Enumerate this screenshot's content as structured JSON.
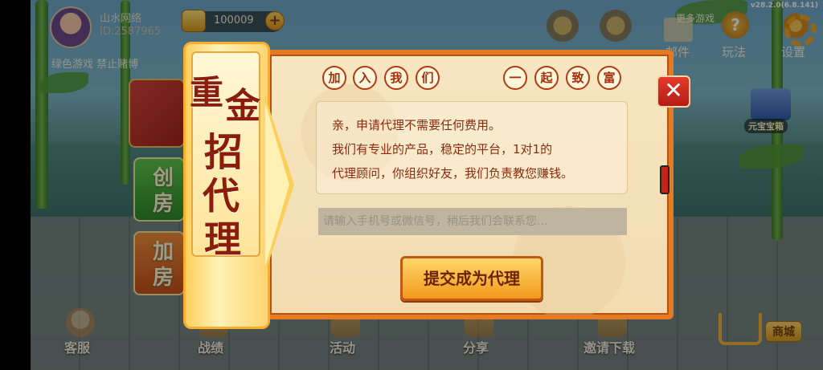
{
  "version": "v28.2.0(6.8.141)",
  "user": {
    "name": "山水网络",
    "id_text": "ID:2587965",
    "tagline": "绿色游戏  禁止赌博"
  },
  "currency": {
    "gold_amount": "100009",
    "add_symbol": "+"
  },
  "top_menu": {
    "more_games": "更多游戏",
    "mail": "邮件",
    "help": "玩法",
    "settings": "设置",
    "help_glyph": "?"
  },
  "left_panel": {
    "create_room": [
      "创",
      "房"
    ],
    "join_room": [
      "加",
      "房"
    ]
  },
  "treasure": {
    "label": "元宝宝箱"
  },
  "bottom_nav": {
    "service": "客服",
    "record": "战绩",
    "activity": "活动",
    "share": "分享",
    "invite": "邀请下载",
    "shop": "商城"
  },
  "modal": {
    "banner_chars": [
      "重",
      "金",
      "招",
      "代",
      "理"
    ],
    "join_chars": [
      "加",
      "入",
      "我",
      "们"
    ],
    "together_chars": [
      "一",
      "起",
      "致",
      "富"
    ],
    "message_lines": [
      "亲，申请代理不需要任何费用。",
      "我们有专业的产品，稳定的平台，1对1的",
      "代理顾问，你组织好友，我们负责教您赚钱。"
    ],
    "input_placeholder": "请输入手机号或微信号，稍后我们会联系您...",
    "input_value": "",
    "submit_label": "提交成为代理",
    "close_symbol": "✕"
  },
  "colors": {
    "modal_border": "#e47a24",
    "text_red": "#8b2a10",
    "close_red": "#c62216"
  }
}
